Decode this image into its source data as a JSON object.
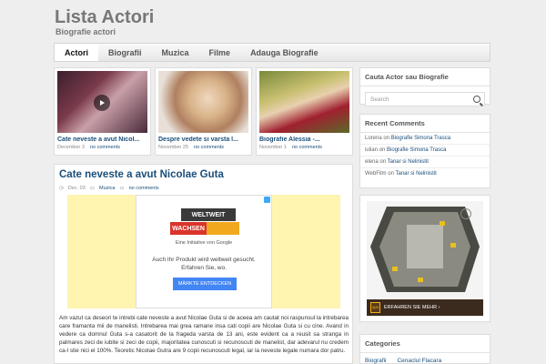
{
  "header": {
    "site_title": "Lista Actori",
    "site_description": "Biografie actori"
  },
  "nav": {
    "items": [
      {
        "label": "Actori",
        "active": true
      },
      {
        "label": "Biografii",
        "active": false
      },
      {
        "label": "Muzica",
        "active": false
      },
      {
        "label": "Filme",
        "active": false
      },
      {
        "label": "Adauga Biografie",
        "active": false
      }
    ]
  },
  "featured": [
    {
      "title": "Cate neveste a avut Nicol...",
      "date": "December 3",
      "comments": "no comments",
      "thumb_icon": "video-play-icon"
    },
    {
      "title": "Despre vedete si varsta l...",
      "date": "November 25",
      "comments": "no comments",
      "thumb_icon": "photo-icon"
    },
    {
      "title": "Biografie Alessia -...",
      "date": "November 1",
      "comments": "no comments",
      "thumb_icon": "photo-icon"
    }
  ],
  "post": {
    "title": "Cate neveste a avut Nicolae Guta",
    "date": "Dec. 03",
    "category": "Muzica",
    "comments": "no comments",
    "ad": {
      "logo_line1": "WELTWEIT",
      "logo_line2": "WACHSEN",
      "initiative": "Eine Initiative von Google",
      "text_line1": "Auch Ihr Produkt wird weltweit gesucht.",
      "text_line2": "Erfahren Sie, wo.",
      "button": "MÄRKTE ENTDECKEN"
    },
    "body": "Am vazut ca deseori te intrebi cate neveste a avut Nicolae Guta si de aceea am cautat noi raspunsul la intrebarea care framanta mii de manelisti. Intrebarea mai grea ramane insa cati copii are Nicolae Guta si cu cine. Avand in vedere ca domnul Guta s-a casatorit de la frageda varsta de 13 ani, este evident ca a reusit sa stranga in palmares zeci de iubite si zeci de copii, majoritatea cunoscuti si recunoscuti de manelist, dar adevarul nu credem ca-l stie nici el 100%. Teoretic Nicolae Gutra are 9 copii recunoscuti legal, iar la neveste legale numara dor patru."
  },
  "sidebar": {
    "search": {
      "title": "Cauta Actor sau Biografie",
      "placeholder": "Search"
    },
    "recent_comments": {
      "title": "Recent Comments",
      "items": [
        {
          "author": "Lorena",
          "on": "on",
          "post": "Biografie Simona Trasca"
        },
        {
          "author": "iulian",
          "on": "on",
          "post": "Biografie Simona Trasca"
        },
        {
          "author": "elena",
          "on": "on",
          "post": "Tanar si Nelinistit"
        },
        {
          "author": "WebFilm",
          "on": "on",
          "post": "Tanar si Nelinistit"
        }
      ]
    },
    "ad": {
      "ball_label": "1",
      "logo": "ups",
      "bar_text": "ERFAHREN SIE MEHR ›"
    },
    "categories": {
      "title": "Categories",
      "items": [
        "Biografii",
        "Cenaclul Flacara"
      ]
    }
  },
  "colors": {
    "link": "#1a4e7a",
    "background": "#eeeeee",
    "ad_yellow": "#fff4b0",
    "ad_button": "#4285f4"
  }
}
